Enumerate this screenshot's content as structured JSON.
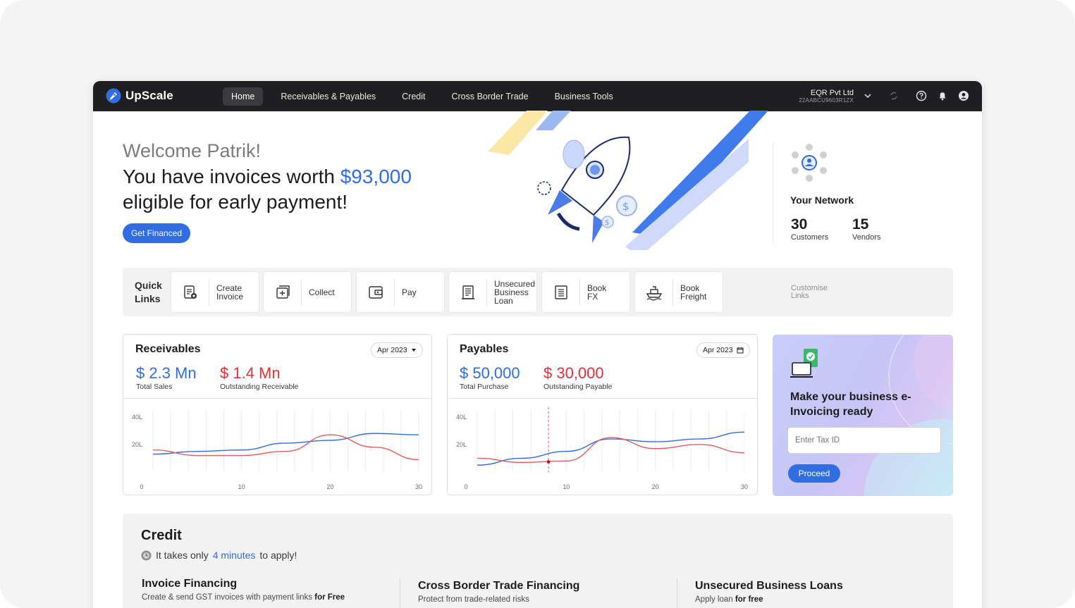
{
  "app": {
    "name": "UpScale"
  },
  "nav": {
    "items": [
      {
        "label": "Home",
        "active": true
      },
      {
        "label": "Receivables & Payables",
        "active": false
      },
      {
        "label": "Credit",
        "active": false
      },
      {
        "label": "Cross Border Trade",
        "active": false
      },
      {
        "label": "Business Tools",
        "active": false
      }
    ]
  },
  "company": {
    "name": "EQR Pvt Ltd",
    "id": "22AABCU9603R1ZX"
  },
  "topbar_icons": [
    "chevron-down-icon",
    "sync-icon",
    "help-icon",
    "bell-icon",
    "user-icon"
  ],
  "hero": {
    "welcome": "Welcome Patrik!",
    "headline_pre": "You have invoices worth ",
    "headline_amount": "$93,000",
    "headline_post": "eligible for early payment!",
    "cta": "Get Financed"
  },
  "network": {
    "title": "Your Network",
    "customers_count": "30",
    "customers_label": "Customers",
    "vendors_count": "15",
    "vendors_label": "Vendors"
  },
  "quick_links": {
    "title": "Quick\nLinks",
    "items": [
      {
        "label": "Create\nInvoice",
        "icon": "create-invoice-icon"
      },
      {
        "label": "Collect",
        "icon": "collect-icon"
      },
      {
        "label": "Pay",
        "icon": "pay-icon"
      },
      {
        "label": "Unsecured\nBusiness\nLoan",
        "icon": "loan-icon"
      },
      {
        "label": "Book\nFX",
        "icon": "fx-icon"
      },
      {
        "label": "Book\nFreight",
        "icon": "ship-icon"
      }
    ],
    "customise": "Customise\nLinks"
  },
  "receivables": {
    "title": "Receivables",
    "period": "Apr 2023",
    "total_value": "$ 2.3 Mn",
    "total_label": "Total Sales",
    "outstanding_value": "$ 1.4 Mn",
    "outstanding_label": "Outstanding Receivable"
  },
  "payables": {
    "title": "Payables",
    "period": "Apr 2023",
    "total_value": "$ 50,000",
    "total_label": "Total Purchase",
    "outstanding_value": "$ 30,000",
    "outstanding_label": "Outstanding Payable"
  },
  "chart_data": [
    {
      "type": "line",
      "name": "receivables-chart",
      "x": [
        0,
        5,
        10,
        15,
        20,
        25,
        30
      ],
      "x_ticks": [
        "0",
        "10",
        "20",
        "30"
      ],
      "y_ticks": [
        "40L",
        "20L"
      ],
      "ylim": [
        0,
        45
      ],
      "series": [
        {
          "color": "#2f6de1",
          "values": [
            13,
            15,
            16,
            21,
            23,
            28,
            27
          ]
        },
        {
          "color": "#e65a62",
          "values": [
            16,
            12,
            12,
            15,
            27,
            18,
            9
          ]
        }
      ]
    },
    {
      "type": "line",
      "name": "payables-chart",
      "x": [
        0,
        5,
        10,
        15,
        20,
        25,
        30
      ],
      "x_ticks": [
        "0",
        "10",
        "20",
        "30"
      ],
      "y_ticks": [
        "40L",
        "20L"
      ],
      "ylim": [
        0,
        45
      ],
      "series": [
        {
          "color": "#2f6de1",
          "values": [
            5,
            10,
            15,
            24,
            22,
            24,
            29
          ]
        },
        {
          "color": "#e65a62",
          "values": [
            10,
            7,
            8,
            25,
            17,
            20,
            14
          ]
        }
      ]
    }
  ],
  "promo": {
    "title": "Make your business e-Invoicing ready",
    "placeholder": "Enter Tax ID",
    "button": "Proceed"
  },
  "credit": {
    "title": "Credit",
    "subtitle_pre": "It takes only",
    "subtitle_highlight": "4 minutes",
    "subtitle_post": "to apply!",
    "items": [
      {
        "title": "Invoice Financing",
        "desc": "Create & send GST invoices with payment links",
        "desc_bold": "for Free"
      },
      {
        "title": "Cross Border Trade Financing",
        "desc": "Protect from trade-related risks",
        "desc_bold": ""
      },
      {
        "title": "Unsecured Business Loans",
        "desc": "Apply loan",
        "desc_bold": "for free"
      }
    ]
  },
  "colors": {
    "accent": "#2f6de1",
    "negative": "#e0303a",
    "topbar": "#1f1f21"
  }
}
